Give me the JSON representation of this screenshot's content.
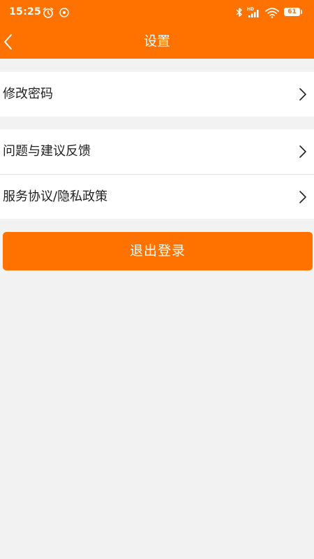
{
  "status_bar": {
    "time": "15:25",
    "battery_level": "61",
    "icons": [
      "alarm-icon",
      "notification-icon",
      "bluetooth-icon",
      "hd-signal-icon",
      "wifi-icon",
      "battery-icon"
    ]
  },
  "header": {
    "title": "设置",
    "back_icon": "chevron-left-icon"
  },
  "settings": {
    "groups": [
      {
        "items": [
          {
            "label": "修改密码"
          }
        ]
      },
      {
        "items": [
          {
            "label": "问题与建议反馈"
          },
          {
            "label": "服务协议/隐私政策"
          }
        ]
      }
    ]
  },
  "logout": {
    "label": "退出登录"
  },
  "colors": {
    "accent": "#ff7200",
    "background": "#f2f2f2",
    "card": "#ffffff",
    "text": "#222222",
    "divider": "#e6e6e6"
  }
}
